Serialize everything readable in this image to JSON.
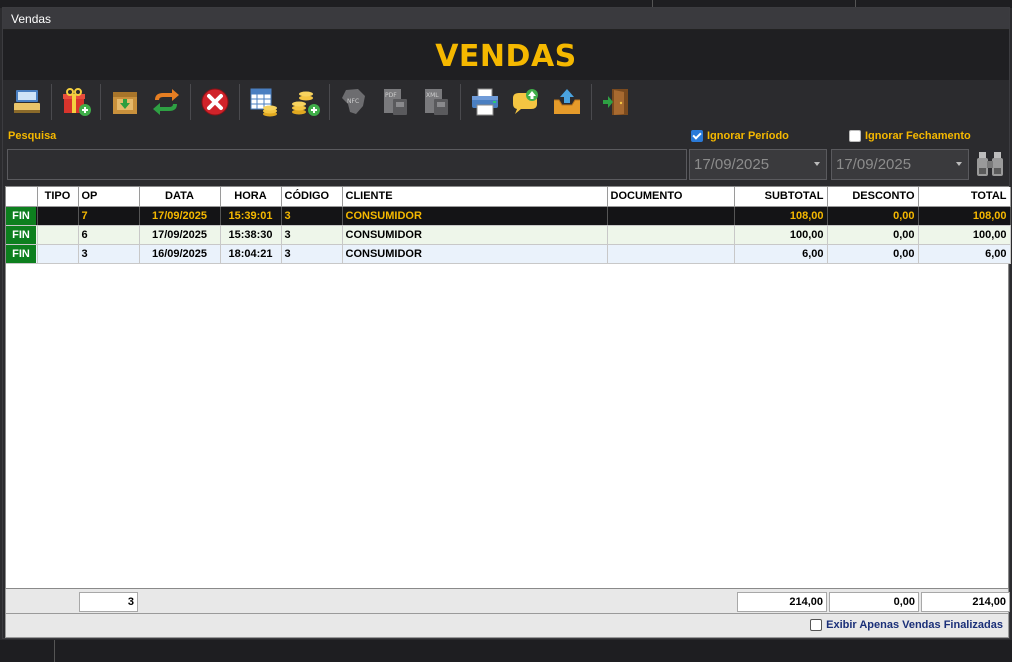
{
  "window": {
    "title": "Vendas"
  },
  "header": {
    "title": "VENDAS"
  },
  "toolbar": {
    "buttons": [
      {
        "name": "view-sale-button",
        "icon": "cash-register-icon"
      },
      {
        "name": "new-sale-button",
        "icon": "gift-add-icon"
      },
      {
        "name": "open-sale-button",
        "icon": "box-download-icon"
      },
      {
        "name": "refresh-button",
        "icon": "refresh-arrows-icon"
      },
      {
        "name": "cancel-sale-button",
        "icon": "cancel-x-icon"
      },
      {
        "name": "report-button",
        "icon": "spreadsheet-coins-icon"
      },
      {
        "name": "add-payment-button",
        "icon": "coins-add-icon"
      },
      {
        "name": "nfce-button",
        "icon": "nfce-brazil-icon"
      },
      {
        "name": "pdf-button",
        "icon": "pdf-document-icon"
      },
      {
        "name": "xml-button",
        "icon": "xml-document-icon"
      },
      {
        "name": "print-button",
        "icon": "printer-icon"
      },
      {
        "name": "send-message-button",
        "icon": "chat-upload-icon"
      },
      {
        "name": "export-button",
        "icon": "tray-upload-icon"
      },
      {
        "name": "exit-button",
        "icon": "door-exit-icon"
      }
    ]
  },
  "filters": {
    "search_label": "Pesquisa",
    "search_value": "",
    "ignore_period_label": "Ignorar Período",
    "ignore_period_checked": true,
    "ignore_closing_label": "Ignorar Fechamento",
    "ignore_closing_checked": false,
    "date_from": "17/09/2025",
    "date_to": "17/09/2025"
  },
  "grid": {
    "columns": [
      "",
      "TIPO",
      "OP",
      "DATA",
      "HORA",
      "CÓDIGO",
      "CLIENTE",
      "DOCUMENTO",
      "SUBTOTAL",
      "DESCONTO",
      "TOTAL"
    ],
    "rows": [
      {
        "status": "FIN",
        "tipo": "",
        "op": "7",
        "data": "17/09/2025",
        "hora": "15:39:01",
        "codigo": "3",
        "cliente": "CONSUMIDOR",
        "documento": "",
        "subtotal": "108,00",
        "desconto": "0,00",
        "total": "108,00",
        "selected": true
      },
      {
        "status": "FIN",
        "tipo": "",
        "op": "6",
        "data": "17/09/2025",
        "hora": "15:38:30",
        "codigo": "3",
        "cliente": "CONSUMIDOR",
        "documento": "",
        "subtotal": "100,00",
        "desconto": "0,00",
        "total": "100,00",
        "selected": false
      },
      {
        "status": "FIN",
        "tipo": "",
        "op": "3",
        "data": "16/09/2025",
        "hora": "18:04:21",
        "codigo": "3",
        "cliente": "CONSUMIDOR",
        "documento": "",
        "subtotal": "6,00",
        "desconto": "0,00",
        "total": "6,00",
        "selected": false
      }
    ]
  },
  "totals": {
    "count": "3",
    "subtotal": "214,00",
    "desconto": "0,00",
    "total": "214,00"
  },
  "bottom": {
    "only_finalized_label": "Exibir Apenas Vendas Finalizadas",
    "only_finalized_checked": false
  },
  "colors": {
    "accent": "#f5b800",
    "selected_row": "#141416",
    "status_badge": "#0d7f1e",
    "link_text": "#1a2f78"
  }
}
